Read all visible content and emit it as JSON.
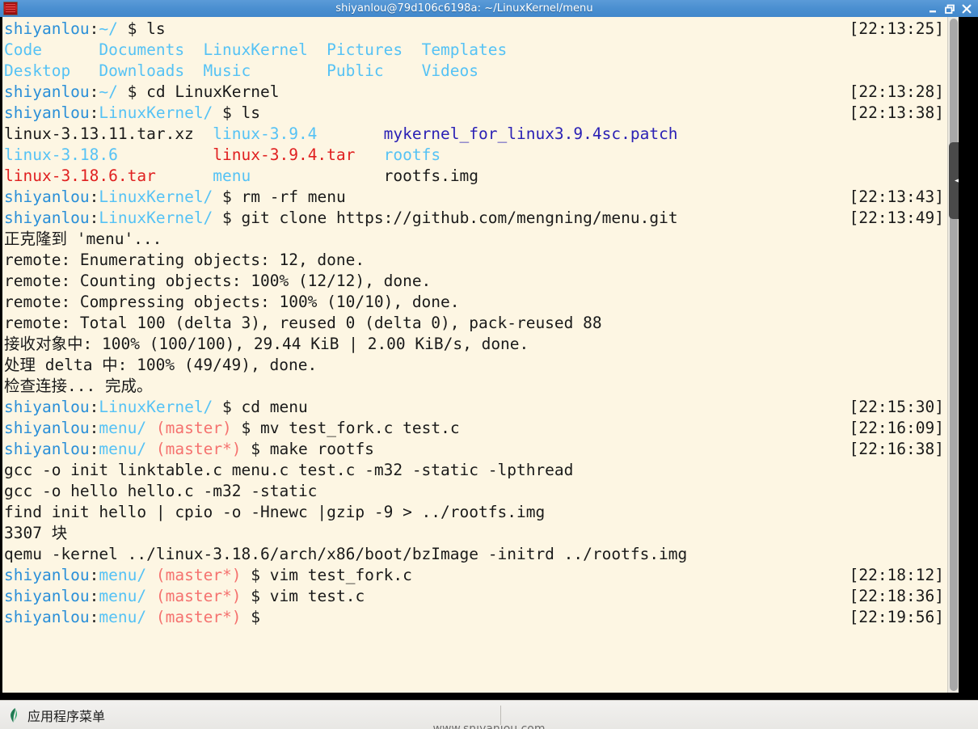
{
  "window": {
    "title": "shiyanlou@79d106c6198a: ~/LinuxKernel/menu",
    "icon": "terminal-icon",
    "buttons": {
      "minimize": "–",
      "maximize": "❐",
      "close": "✕"
    }
  },
  "terminal": {
    "background_color": "#fdf6e3",
    "foreground_color": "#1a1a1a",
    "prompt_user": "shiyanlou",
    "colors": {
      "user": "#2a8fd8",
      "path": "#55c2f5",
      "branch": "#f5726f",
      "directory": "#55c2f5",
      "archive": "#e02020",
      "patch": "#2b21b5",
      "plain": "#1a1a1a"
    },
    "lines": [
      {
        "type": "prompt",
        "user": "shiyanlou",
        "path": "~/",
        "branch": "",
        "command": "ls",
        "timestamp": "[22:13:25]"
      },
      {
        "type": "output",
        "segments": [
          {
            "text": "Code      ",
            "cls": "dir"
          },
          {
            "text": "Documents  ",
            "cls": "dir"
          },
          {
            "text": "LinuxKernel  ",
            "cls": "dir"
          },
          {
            "text": "Pictures  ",
            "cls": "dir"
          },
          {
            "text": "Templates",
            "cls": "dir"
          }
        ]
      },
      {
        "type": "output",
        "segments": [
          {
            "text": "Desktop   ",
            "cls": "dir"
          },
          {
            "text": "Downloads  ",
            "cls": "dir"
          },
          {
            "text": "Music        ",
            "cls": "dir"
          },
          {
            "text": "Public    ",
            "cls": "dir"
          },
          {
            "text": "Videos",
            "cls": "dir"
          }
        ]
      },
      {
        "type": "prompt",
        "user": "shiyanlou",
        "path": "~/",
        "branch": "",
        "command": "cd LinuxKernel",
        "timestamp": "[22:13:28]"
      },
      {
        "type": "prompt",
        "user": "shiyanlou",
        "path": "LinuxKernel/",
        "branch": "",
        "command": "ls",
        "timestamp": "[22:13:38]"
      },
      {
        "type": "output",
        "segments": [
          {
            "text": "linux-3.13.11.tar.xz  ",
            "cls": "plain"
          },
          {
            "text": "linux-3.9.4       ",
            "cls": "dir"
          },
          {
            "text": "mykernel_for_linux3.9.4sc.patch",
            "cls": "patch"
          }
        ]
      },
      {
        "type": "output",
        "segments": [
          {
            "text": "linux-3.18.6",
            "cls": "dir"
          },
          {
            "text": "          ",
            "cls": "plain"
          },
          {
            "text": "linux-3.9.4.tar   ",
            "cls": "arc"
          },
          {
            "text": "rootfs",
            "cls": "dir"
          }
        ]
      },
      {
        "type": "output",
        "segments": [
          {
            "text": "linux-3.18.6.tar",
            "cls": "arc"
          },
          {
            "text": "      ",
            "cls": "plain"
          },
          {
            "text": "menu",
            "cls": "dir"
          },
          {
            "text": "              ",
            "cls": "plain"
          },
          {
            "text": "rootfs.img",
            "cls": "plain"
          }
        ]
      },
      {
        "type": "prompt",
        "user": "shiyanlou",
        "path": "LinuxKernel/",
        "branch": "",
        "command": "rm -rf menu",
        "timestamp": "[22:13:43]"
      },
      {
        "type": "prompt",
        "user": "shiyanlou",
        "path": "LinuxKernel/",
        "branch": "",
        "command": "git clone https://github.com/mengning/menu.git",
        "timestamp": "[22:13:49]"
      },
      {
        "type": "output",
        "segments": [
          {
            "text": "正克隆到 'menu'...",
            "cls": "plain"
          }
        ]
      },
      {
        "type": "output",
        "segments": [
          {
            "text": "remote: Enumerating objects: 12, done.",
            "cls": "plain"
          }
        ]
      },
      {
        "type": "output",
        "segments": [
          {
            "text": "remote: Counting objects: 100% (12/12), done.",
            "cls": "plain"
          }
        ]
      },
      {
        "type": "output",
        "segments": [
          {
            "text": "remote: Compressing objects: 100% (10/10), done.",
            "cls": "plain"
          }
        ]
      },
      {
        "type": "output",
        "segments": [
          {
            "text": "remote: Total 100 (delta 3), reused 0 (delta 0), pack-reused 88",
            "cls": "plain"
          }
        ]
      },
      {
        "type": "output",
        "segments": [
          {
            "text": "接收对象中: 100% (100/100), 29.44 KiB | 2.00 KiB/s, done.",
            "cls": "plain"
          }
        ]
      },
      {
        "type": "output",
        "segments": [
          {
            "text": "处理 delta 中: 100% (49/49), done.",
            "cls": "plain"
          }
        ]
      },
      {
        "type": "output",
        "segments": [
          {
            "text": "检查连接... 完成。",
            "cls": "plain"
          }
        ]
      },
      {
        "type": "prompt",
        "user": "shiyanlou",
        "path": "LinuxKernel/",
        "branch": "",
        "command": "cd menu",
        "timestamp": "[22:15:30]"
      },
      {
        "type": "prompt",
        "user": "shiyanlou",
        "path": "menu/",
        "branch": "(master)",
        "command": "mv test_fork.c test.c",
        "timestamp": "[22:16:09]"
      },
      {
        "type": "prompt",
        "user": "shiyanlou",
        "path": "menu/",
        "branch": "(master*)",
        "command": "make rootfs",
        "timestamp": "[22:16:38]"
      },
      {
        "type": "output",
        "segments": [
          {
            "text": "gcc -o init linktable.c menu.c test.c -m32 -static -lpthread",
            "cls": "plain"
          }
        ]
      },
      {
        "type": "output",
        "segments": [
          {
            "text": "gcc -o hello hello.c -m32 -static",
            "cls": "plain"
          }
        ]
      },
      {
        "type": "output",
        "segments": [
          {
            "text": "find init hello | cpio -o -Hnewc |gzip -9 > ../rootfs.img",
            "cls": "plain"
          }
        ]
      },
      {
        "type": "output",
        "segments": [
          {
            "text": "3307 块",
            "cls": "plain"
          }
        ]
      },
      {
        "type": "output",
        "segments": [
          {
            "text": "qemu -kernel ../linux-3.18.6/arch/x86/boot/bzImage -initrd ../rootfs.img",
            "cls": "plain"
          }
        ]
      },
      {
        "type": "prompt",
        "user": "shiyanlou",
        "path": "menu/",
        "branch": "(master*)",
        "command": "vim test_fork.c",
        "timestamp": "[22:18:12]"
      },
      {
        "type": "prompt",
        "user": "shiyanlou",
        "path": "menu/",
        "branch": "(master*)",
        "command": "vim test.c",
        "timestamp": "[22:18:36]"
      },
      {
        "type": "prompt",
        "user": "shiyanlou",
        "path": "menu/",
        "branch": "(master*)",
        "command": "",
        "timestamp": "[22:19:56]"
      }
    ]
  },
  "taskbar": {
    "app_menu_label": "应用程序菜单",
    "app_menu_icon": "leaf-icon"
  },
  "watermark": {
    "text": "www.shiyanlou.com"
  }
}
